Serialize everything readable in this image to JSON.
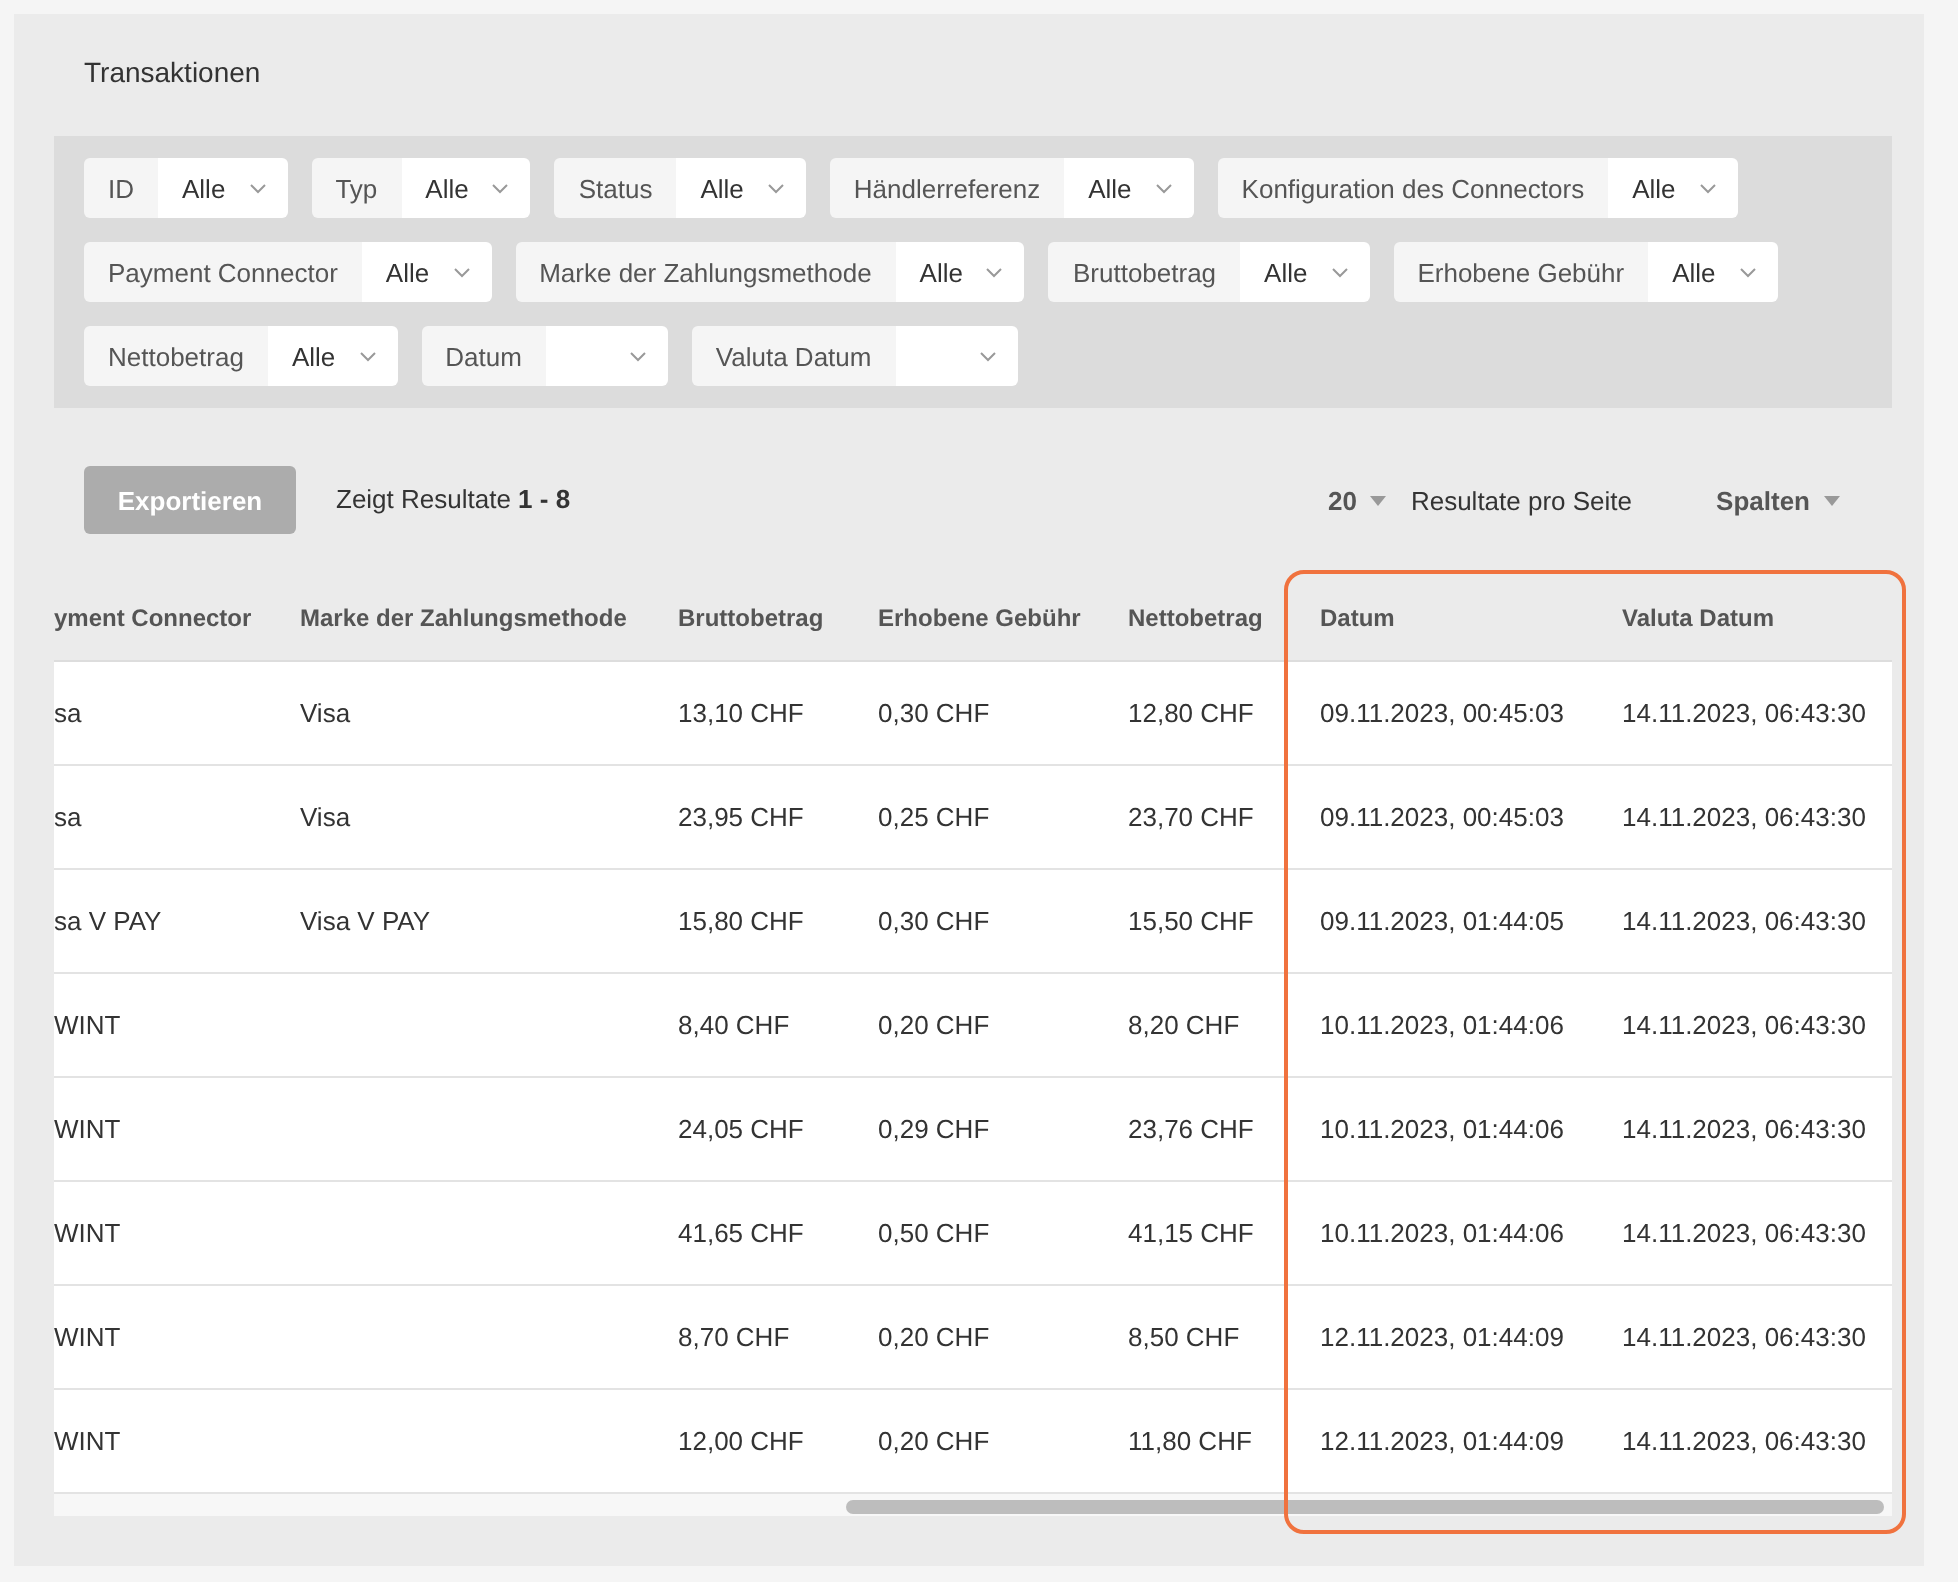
{
  "title": "Transaktionen",
  "filters": [
    {
      "label": "ID",
      "value": "Alle"
    },
    {
      "label": "Typ",
      "value": "Alle"
    },
    {
      "label": "Status",
      "value": "Alle"
    },
    {
      "label": "Händlerreferenz",
      "value": "Alle"
    },
    {
      "label": "Konfiguration des Connectors",
      "value": "Alle"
    },
    {
      "label": "Payment Connector",
      "value": "Alle"
    },
    {
      "label": "Marke der Zahlungsmethode",
      "value": "Alle"
    },
    {
      "label": "Bruttobetrag",
      "value": "Alle"
    },
    {
      "label": "Erhobene Gebühr",
      "value": "Alle"
    },
    {
      "label": "Nettobetrag",
      "value": "Alle"
    },
    {
      "label": "Datum"
    },
    {
      "label": "Valuta Datum"
    }
  ],
  "toolbar": {
    "export_button": "Exportieren",
    "results_text": "Zeigt Resultate **1 - 8**",
    "page_size": "20",
    "page_size_label": "Resultate pro Seite",
    "columns_button": "Spalten"
  },
  "table": {
    "columns": [
      "yment Connector",
      "Marke der Zahlungsmethode",
      "Bruttobetrag",
      "Erhobene Gebühr",
      "Nettobetrag",
      "Datum",
      "Valuta Datum"
    ],
    "date_columns_highlighted": true,
    "rows": [
      [
        "sa",
        "Visa",
        "13,10 CHF",
        "0,30 CHF",
        "12,80 CHF",
        "09.11.2023, 00:45:03",
        "14.11.2023, 06:43:30"
      ],
      [
        "sa",
        "Visa",
        "23,95 CHF",
        "0,25 CHF",
        "23,70 CHF",
        "09.11.2023, 00:45:03",
        "14.11.2023, 06:43:30"
      ],
      [
        "sa V PAY",
        "Visa V PAY",
        "15,80 CHF",
        "0,30 CHF",
        "15,50 CHF",
        "09.11.2023, 01:44:05",
        "14.11.2023, 06:43:30"
      ],
      [
        "WINT",
        "",
        "8,40 CHF",
        "0,20 CHF",
        "8,20 CHF",
        "10.11.2023, 01:44:06",
        "14.11.2023, 06:43:30"
      ],
      [
        "WINT",
        "",
        "24,05 CHF",
        "0,29 CHF",
        "23,76 CHF",
        "10.11.2023, 01:44:06",
        "14.11.2023, 06:43:30"
      ],
      [
        "WINT",
        "",
        "41,65 CHF",
        "0,50 CHF",
        "41,15 CHF",
        "10.11.2023, 01:44:06",
        "14.11.2023, 06:43:30"
      ],
      [
        "WINT",
        "",
        "8,70 CHF",
        "0,20 CHF",
        "8,50 CHF",
        "12.11.2023, 01:44:09",
        "14.11.2023, 06:43:30"
      ],
      [
        "WINT",
        "",
        "12,00 CHF",
        "0,20 CHF",
        "11,80 CHF",
        "12.11.2023, 01:44:09",
        "14.11.2023, 06:43:30"
      ]
    ]
  }
}
